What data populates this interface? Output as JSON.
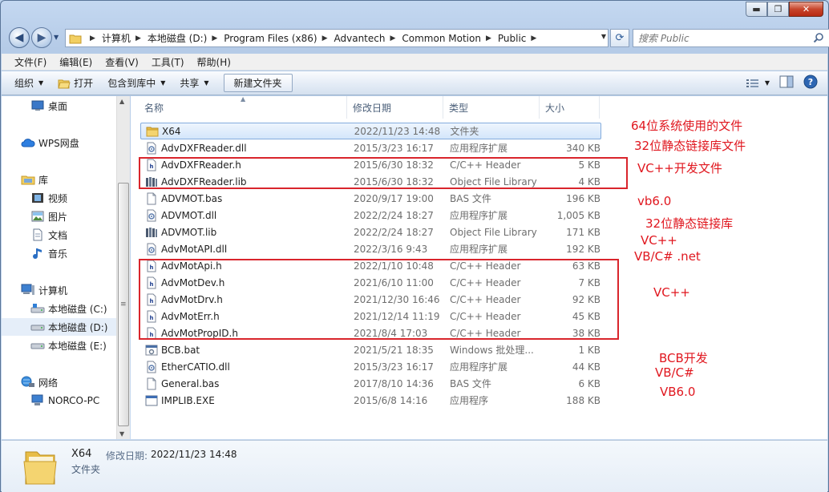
{
  "window": {
    "caption_min": "▬",
    "caption_max": "❐",
    "caption_close": "✕"
  },
  "address": {
    "crumbs": [
      "计算机",
      "本地磁盘 (D:)",
      "Program Files (x86)",
      "Advantech",
      "Common Motion",
      "Public"
    ],
    "search_placeholder": "搜索 Public"
  },
  "menubar": {
    "items": [
      "文件(F)",
      "编辑(E)",
      "查看(V)",
      "工具(T)",
      "帮助(H)"
    ]
  },
  "cmdbar": {
    "organize": "组织",
    "open": "打开",
    "include": "包含到库中",
    "share": "共享",
    "new_folder": "新建文件夹"
  },
  "navpane": {
    "items": [
      {
        "label": "桌面",
        "icon": "desktop-icon"
      },
      {
        "label": "WPS网盘",
        "icon": "cloud-icon"
      },
      {
        "label": "库",
        "icon": "library-icon"
      },
      {
        "label": "视频",
        "icon": "video-icon"
      },
      {
        "label": "图片",
        "icon": "picture-icon"
      },
      {
        "label": "文档",
        "icon": "document-icon"
      },
      {
        "label": "音乐",
        "icon": "music-icon"
      },
      {
        "label": "计算机",
        "icon": "computer-icon"
      },
      {
        "label": "本地磁盘 (C:)",
        "icon": "drive-icon"
      },
      {
        "label": "本地磁盘 (D:)",
        "icon": "drive-icon"
      },
      {
        "label": "本地磁盘 (E:)",
        "icon": "drive-icon"
      },
      {
        "label": "网络",
        "icon": "network-icon"
      },
      {
        "label": "NORCO-PC",
        "icon": "pc-icon"
      }
    ]
  },
  "columns": {
    "name": "名称",
    "date": "修改日期",
    "type": "类型",
    "size": "大小"
  },
  "files": [
    {
      "name": "X64",
      "date": "2022/11/23 14:48",
      "type": "文件夹",
      "size": "",
      "icon": "folder-icon",
      "selected": true
    },
    {
      "name": "AdvDXFReader.dll",
      "date": "2015/3/23 16:17",
      "type": "应用程序扩展",
      "size": "340 KB",
      "icon": "dll-icon"
    },
    {
      "name": "AdvDXFReader.h",
      "date": "2015/6/30 18:32",
      "type": "C/C++ Header",
      "size": "5 KB",
      "icon": "header-icon"
    },
    {
      "name": "AdvDXFReader.lib",
      "date": "2015/6/30 18:32",
      "type": "Object File Library",
      "size": "4 KB",
      "icon": "lib-icon"
    },
    {
      "name": "ADVMOT.bas",
      "date": "2020/9/17 19:00",
      "type": "BAS 文件",
      "size": "196 KB",
      "icon": "file-icon"
    },
    {
      "name": "ADVMOT.dll",
      "date": "2022/2/24 18:27",
      "type": "应用程序扩展",
      "size": "1,005 KB",
      "icon": "dll-icon"
    },
    {
      "name": "ADVMOT.lib",
      "date": "2022/2/24 18:27",
      "type": "Object File Library",
      "size": "171 KB",
      "icon": "lib-icon"
    },
    {
      "name": "AdvMotAPI.dll",
      "date": "2022/3/16 9:43",
      "type": "应用程序扩展",
      "size": "192 KB",
      "icon": "dll-icon"
    },
    {
      "name": "AdvMotApi.h",
      "date": "2022/1/10 10:48",
      "type": "C/C++ Header",
      "size": "63 KB",
      "icon": "header-icon"
    },
    {
      "name": "AdvMotDev.h",
      "date": "2021/6/10 11:00",
      "type": "C/C++ Header",
      "size": "7 KB",
      "icon": "header-icon"
    },
    {
      "name": "AdvMotDrv.h",
      "date": "2021/12/30 16:46",
      "type": "C/C++ Header",
      "size": "92 KB",
      "icon": "header-icon"
    },
    {
      "name": "AdvMotErr.h",
      "date": "2021/12/14 11:19",
      "type": "C/C++ Header",
      "size": "45 KB",
      "icon": "header-icon"
    },
    {
      "name": "AdvMotPropID.h",
      "date": "2021/8/4 17:03",
      "type": "C/C++ Header",
      "size": "38 KB",
      "icon": "header-icon"
    },
    {
      "name": "BCB.bat",
      "date": "2021/5/21 18:35",
      "type": "Windows 批处理...",
      "size": "1 KB",
      "icon": "bat-icon"
    },
    {
      "name": "EtherCATIO.dll",
      "date": "2015/3/23 16:17",
      "type": "应用程序扩展",
      "size": "44 KB",
      "icon": "dll-icon"
    },
    {
      "name": "General.bas",
      "date": "2017/8/10 14:36",
      "type": "BAS 文件",
      "size": "6 KB",
      "icon": "file-icon"
    },
    {
      "name": "IMPLIB.EXE",
      "date": "2015/6/8 14:16",
      "type": "应用程序",
      "size": "188 KB",
      "icon": "exe-icon"
    }
  ],
  "annotations": [
    "64位系统使用的文件",
    "32位静态链接库文件",
    "VC++开发文件",
    "vb6.0",
    "32位静态链接库",
    "VC++",
    "VB/C#  .net",
    "VC++",
    "BCB开发",
    "VB/C#",
    "VB6.0"
  ],
  "details": {
    "name": "X64",
    "modified_label": "修改日期:",
    "modified": "2022/11/23 14:48",
    "type": "文件夹"
  },
  "colors": {
    "annotation_red": "#e0161e",
    "selection_blue": "#84acdd"
  }
}
